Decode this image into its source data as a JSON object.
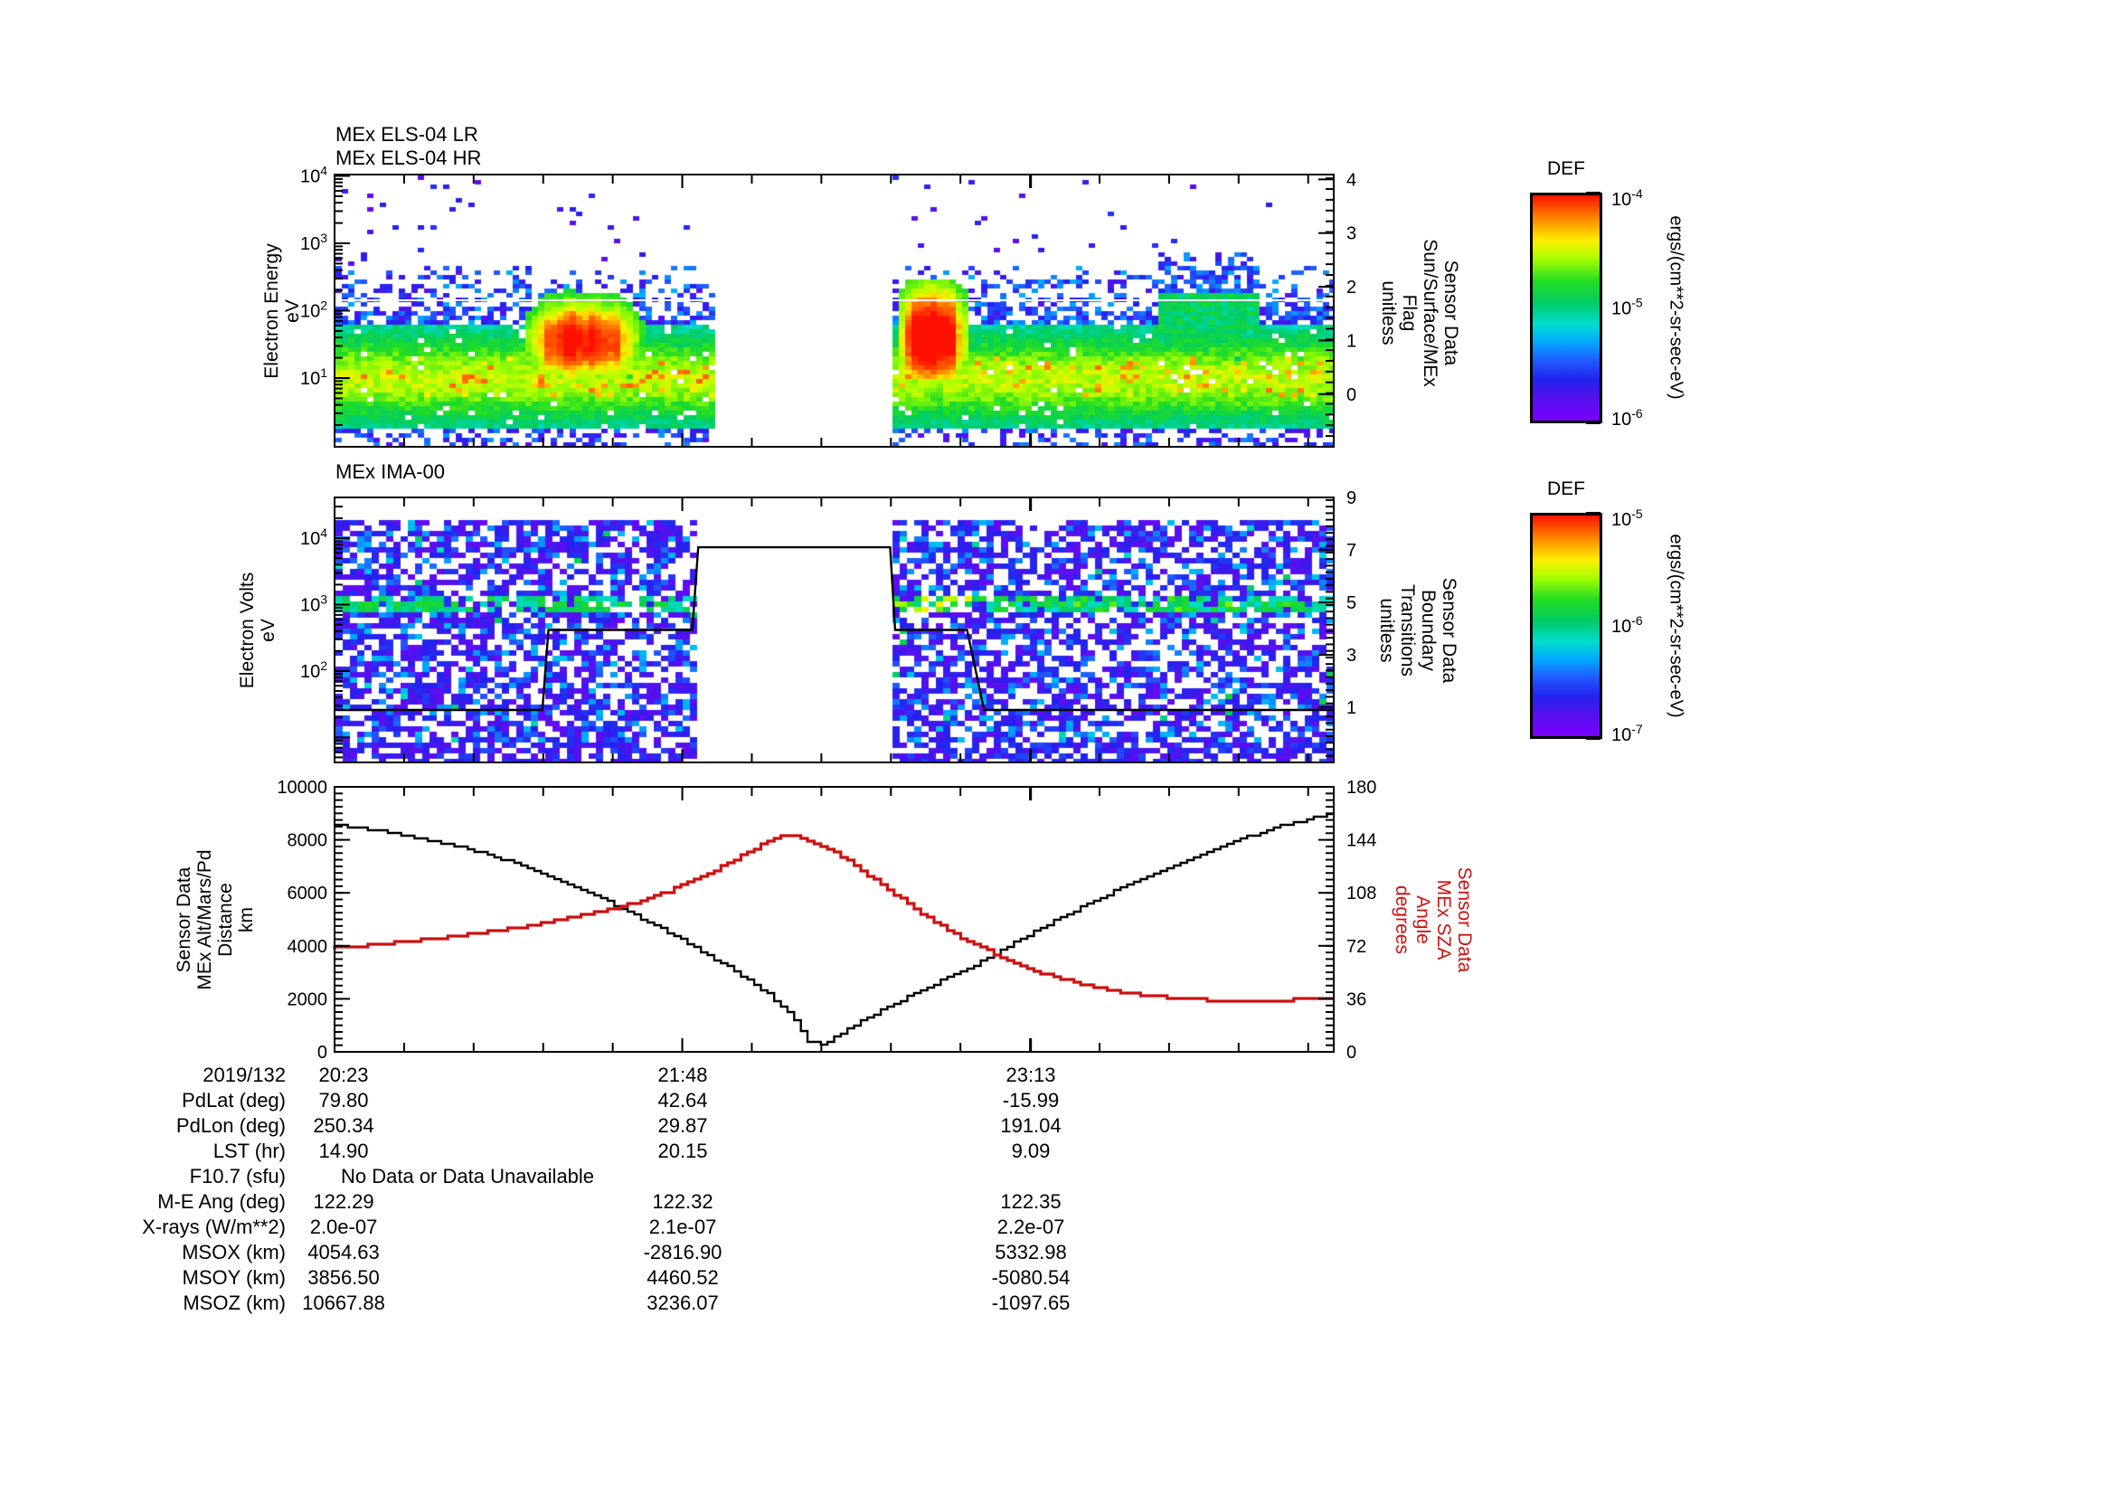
{
  "chart_data": [
    {
      "id": "els",
      "type": "heatmap",
      "titles": [
        "MEx ELS-04 LR",
        "MEx ELS-04 HR"
      ],
      "left_label_lines": [
        "Electron Energy",
        "eV"
      ],
      "right_label_lines": [
        "Sensor Data",
        "Sun/Surface/MEx",
        "Flag",
        "unitless"
      ],
      "y_axis_log": {
        "log_top": 4.02,
        "log_bottom": -0.02,
        "labeled_decades": [
          4,
          3,
          2,
          1
        ]
      },
      "right_axis": {
        "min": -0.98,
        "max": 4.09,
        "majors": [
          4,
          3,
          2,
          1,
          0
        ],
        "minor_step": 0.2
      },
      "spectrogram": {
        "seed": 42,
        "cell": [
          7,
          5
        ],
        "x_gap": [
          0.377,
          0.56
        ],
        "band": {
          "center_log": 1.0,
          "sigma": 0.45
        },
        "blobs": [
          {
            "x0": 0.184,
            "x1": 0.312,
            "center_log": 1.55,
            "sigma": 0.4,
            "strength": 1.05
          },
          {
            "x0": 0.56,
            "x1": 0.635,
            "center_log": 1.6,
            "sigma": 0.52,
            "strength": 1.28
          }
        ],
        "elevated_block": {
          "x0": 0.82,
          "x1": 0.926,
          "log_low": 1.25,
          "log_top": 2.25
        },
        "flag_line_y_frac": 0.462,
        "flag_line_color": "#ffffff"
      }
    },
    {
      "id": "ima",
      "type": "heatmap",
      "title": "MEx IMA-00",
      "left_label_lines": [
        "Electron Volts",
        "eV"
      ],
      "right_label_lines": [
        "Sensor Data",
        "Boundary",
        "Transitions",
        "unitless"
      ],
      "y_axis_log": {
        "log_top": 4.615,
        "log_bottom": 0.623,
        "labeled_decades": [
          4,
          3,
          2
        ],
        "extra_major_decades": [
          1
        ]
      },
      "right_axis": {
        "min": -1.1,
        "max": 9.0,
        "majors": [
          9,
          7,
          5,
          3,
          1
        ],
        "minor_step": 0.25
      },
      "spectrogram": {
        "seed": 1337,
        "cell": [
          8,
          6
        ],
        "x_gap": [
          0.362,
          0.56
        ],
        "band_log": 3.02,
        "data_top_frac": 0.078
      },
      "overlay_line": {
        "color": "#000000",
        "points_fx_yfrac": [
          [
            0,
            0.802
          ],
          [
            0.208,
            0.802
          ],
          [
            0.214,
            0.5
          ],
          [
            0.358,
            0.5
          ],
          [
            0.364,
            0.188
          ],
          [
            0.556,
            0.188
          ],
          [
            0.561,
            0.5
          ],
          [
            0.633,
            0.5
          ],
          [
            0.65,
            0.802
          ],
          [
            1,
            0.802
          ]
        ]
      }
    },
    {
      "id": "ephemeris",
      "type": "line",
      "left_label_lines": [
        "Sensor Data",
        "MEx Alt/Mars/Pd",
        "Distance",
        "km"
      ],
      "right_label_lines": [
        "Sensor Data",
        "MEx SZA",
        "Angle",
        "degrees"
      ],
      "left_axis": {
        "min": 0,
        "max": 10000,
        "major_step": 2000,
        "minor_step": 250
      },
      "right_axis": {
        "min": 0,
        "max": 180,
        "major_step": 36,
        "minor_step": 4.5,
        "color": "#cc1111"
      },
      "series": [
        {
          "name": "mex-altitude",
          "color": "#000000",
          "axis": "left",
          "points": [
            [
              0,
              8600
            ],
            [
              0.05,
              8350
            ],
            [
              0.1,
              8000
            ],
            [
              0.15,
              7550
            ],
            [
              0.2,
              6950
            ],
            [
              0.25,
              6200
            ],
            [
              0.3,
              5300
            ],
            [
              0.35,
              4300
            ],
            [
              0.4,
              3200
            ],
            [
              0.44,
              2200
            ],
            [
              0.465,
              1300
            ],
            [
              0.48,
              350
            ],
            [
              0.495,
              300
            ],
            [
              0.51,
              650
            ],
            [
              0.55,
              1500
            ],
            [
              0.6,
              2450
            ],
            [
              0.65,
              3350
            ],
            [
              0.7,
              4400
            ],
            [
              0.75,
              5400
            ],
            [
              0.8,
              6300
            ],
            [
              0.84,
              6950
            ],
            [
              0.88,
              7550
            ],
            [
              0.92,
              8120
            ],
            [
              0.96,
              8600
            ],
            [
              1,
              8960
            ]
          ]
        },
        {
          "name": "mex-sza",
          "color": "#cc1111",
          "axis": "right",
          "points": [
            [
              0,
              70
            ],
            [
              0.05,
              73
            ],
            [
              0.1,
              76.5
            ],
            [
              0.15,
              80.5
            ],
            [
              0.2,
              85.5
            ],
            [
              0.25,
              92
            ],
            [
              0.3,
              100
            ],
            [
              0.34,
              109
            ],
            [
              0.38,
              121
            ],
            [
              0.41,
              132
            ],
            [
              0.435,
              141
            ],
            [
              0.45,
              146.5
            ],
            [
              0.465,
              147
            ],
            [
              0.48,
              144
            ],
            [
              0.5,
              138
            ],
            [
              0.53,
              125
            ],
            [
              0.56,
              110
            ],
            [
              0.6,
              91
            ],
            [
              0.64,
              75
            ],
            [
              0.68,
              62
            ],
            [
              0.72,
              52
            ],
            [
              0.76,
              45
            ],
            [
              0.8,
              40
            ],
            [
              0.84,
              37
            ],
            [
              0.88,
              35
            ],
            [
              0.92,
              34
            ],
            [
              0.955,
              34
            ],
            [
              0.965,
              36
            ],
            [
              1,
              36
            ]
          ]
        }
      ]
    }
  ],
  "x_axis": {
    "date_label": "2019/132",
    "tick_labels": [
      {
        "text": "20:23",
        "frac": 0.0
      },
      {
        "text": "21:48",
        "frac": 0.348
      },
      {
        "text": "23:13",
        "frac": 0.697
      }
    ],
    "minor_step_frac": 0.0696
  },
  "colorbars": [
    {
      "title": "DEF",
      "unit": "ergs/(cm**2-sr-sec-eV)",
      "tick_labels": [
        {
          "text": "10^-4",
          "frac": 0.0
        },
        {
          "text": "10^-5",
          "frac": 0.5
        },
        {
          "text": "10^-6",
          "frac": 1.0
        }
      ]
    },
    {
      "title": "DEF",
      "unit": "ergs/(cm**2-sr-sec-eV)",
      "tick_labels": [
        {
          "text": "10^-5",
          "frac": 0.0
        },
        {
          "text": "10^-6",
          "frac": 0.5
        },
        {
          "text": "10^-7",
          "frac": 1.0
        }
      ]
    }
  ],
  "table": {
    "rows": [
      {
        "label": "2019/132",
        "c1": "20:23",
        "c2": "21:48",
        "c3": "23:13"
      },
      {
        "label": "PdLat (deg)",
        "c1": "79.80",
        "c2": "42.64",
        "c3": "-15.99"
      },
      {
        "label": "PdLon (deg)",
        "c1": "250.34",
        "c2": "29.87",
        "c3": "191.04"
      },
      {
        "label": "LST (hr)",
        "c1": "14.90",
        "c2": "20.15",
        "c3": "9.09"
      },
      {
        "label": "F10.7 (sfu)",
        "span": "No Data or Data Unavailable"
      },
      {
        "label": "M-E Ang (deg)",
        "c1": "122.29",
        "c2": "122.32",
        "c3": "122.35"
      },
      {
        "label": "X-rays (W/m**2)",
        "c1": "2.0e-07",
        "c2": "2.1e-07",
        "c3": "2.2e-07"
      },
      {
        "label": "MSOX (km)",
        "c1": "4054.63",
        "c2": "-2816.90",
        "c3": "5332.98"
      },
      {
        "label": "MSOY (km)",
        "c1": "3856.50",
        "c2": "4460.52",
        "c3": "-5080.54"
      },
      {
        "label": "MSOZ (km)",
        "c1": "10667.88",
        "c2": "3236.07",
        "c3": "-1097.65"
      }
    ]
  },
  "colors": {
    "axis": "#000000",
    "accent_red": "#cc1111",
    "background": "#ffffff"
  }
}
